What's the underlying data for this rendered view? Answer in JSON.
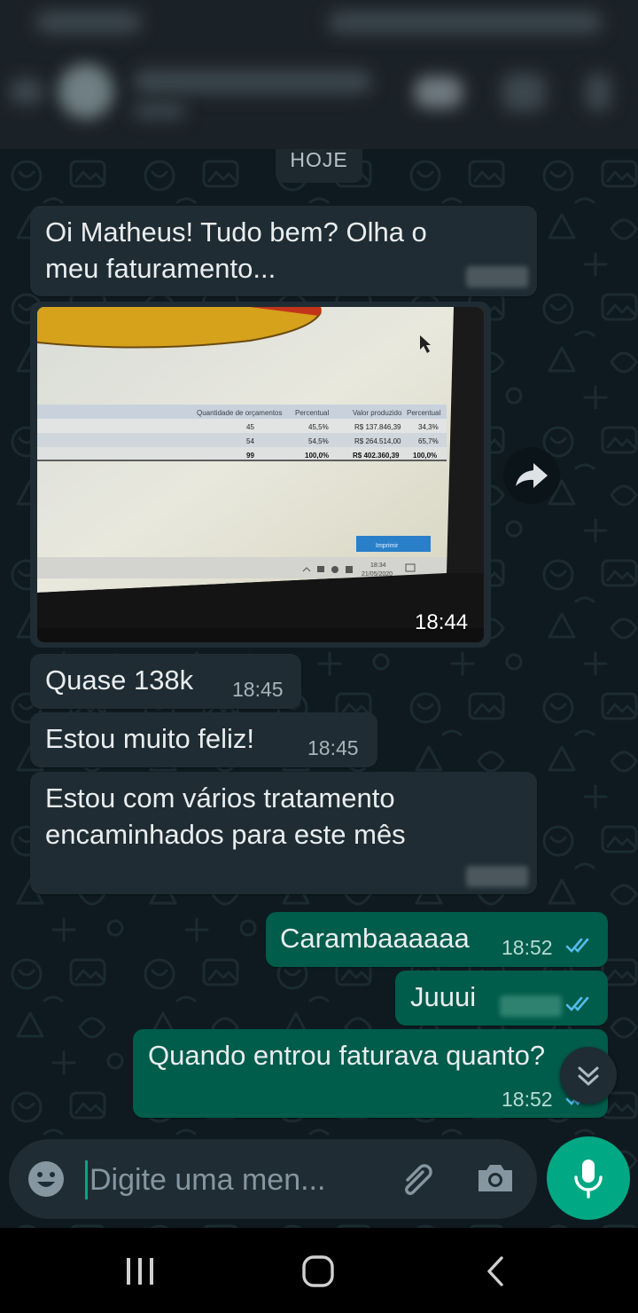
{
  "date_chip": "HOJE",
  "messages": [
    {
      "direction": "incoming",
      "type": "text",
      "lines": [
        "Oi Matheus! Tudo bem? Olha o",
        "meu faturamento..."
      ]
    },
    {
      "direction": "incoming",
      "type": "image",
      "time": "18:44",
      "image_table": {
        "headers": [
          "Quantidade de orçamentos",
          "Percentual",
          "Valor produzido",
          "Percentual"
        ],
        "rows": [
          [
            "45",
            "45,5%",
            "R$ 137.846,39",
            "34,3%"
          ],
          [
            "54",
            "54,5%",
            "R$ 264.514,00",
            "65,7%"
          ],
          [
            "99",
            "100,0%",
            "R$ 402.360,39",
            "100,0%"
          ]
        ],
        "taskbar_time": "18:34",
        "taskbar_date": "21/05/2020",
        "taskbar_label": "Imprimir"
      }
    },
    {
      "direction": "incoming",
      "type": "text",
      "lines": [
        "Quase 138k"
      ],
      "time": "18:45"
    },
    {
      "direction": "incoming",
      "type": "text",
      "lines": [
        "Estou muito feliz!"
      ],
      "time": "18:45"
    },
    {
      "direction": "incoming",
      "type": "text",
      "lines": [
        "Estou com vários tratamento",
        "encaminhados para este mês"
      ]
    },
    {
      "direction": "outgoing",
      "type": "text",
      "lines": [
        "Carambaaaaaa"
      ],
      "time": "18:52"
    },
    {
      "direction": "outgoing",
      "type": "text",
      "lines": [
        "Juuui"
      ]
    },
    {
      "direction": "outgoing",
      "type": "text",
      "lines": [
        "Quando entrou faturava quanto?"
      ],
      "time": "18:52"
    }
  ],
  "composer": {
    "placeholder": "Digite uma men..."
  },
  "icons": {
    "emoji": "emoji-icon",
    "attach": "paperclip-icon",
    "camera": "camera-icon",
    "mic": "mic-icon",
    "forward": "forward-icon",
    "scroll_down": "chevron-double-down-icon",
    "read_receipt": "double-check-icon"
  },
  "colors": {
    "incoming_bubble": "#1f2c33",
    "outgoing_bubble": "#005c4b",
    "accent": "#00a884",
    "read_tick": "#53bdeb"
  }
}
